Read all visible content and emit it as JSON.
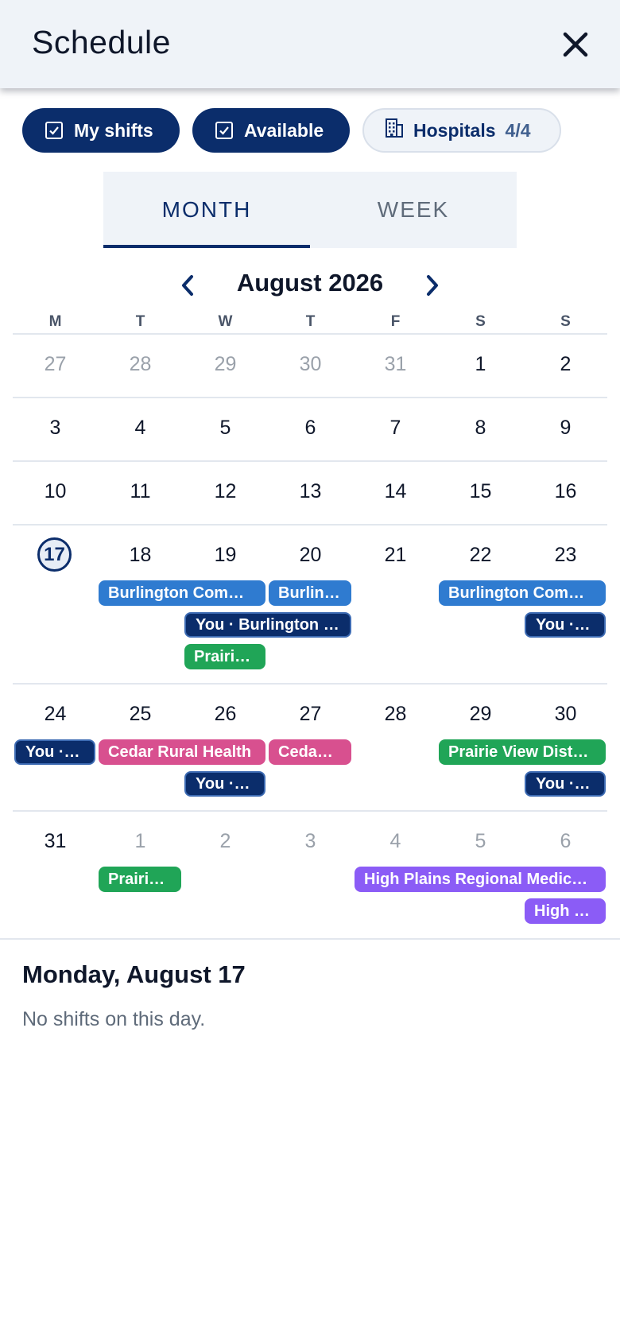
{
  "header": {
    "title": "Schedule"
  },
  "filters": {
    "my_shifts": "My shifts",
    "available": "Available",
    "hospitals_label": "Hospitals",
    "hospitals_count": "4/4"
  },
  "tabs": {
    "month": "MONTH",
    "week": "WEEK",
    "selected": "MONTH"
  },
  "calendar": {
    "month_title": "August 2026",
    "weekdays": [
      "M",
      "T",
      "W",
      "T",
      "F",
      "S",
      "S"
    ],
    "weeks": [
      [
        "27",
        "28",
        "29",
        "30",
        "31",
        "1",
        "2"
      ],
      [
        "3",
        "4",
        "5",
        "6",
        "7",
        "8",
        "9"
      ],
      [
        "10",
        "11",
        "12",
        "13",
        "14",
        "15",
        "16"
      ],
      [
        "17",
        "18",
        "19",
        "20",
        "21",
        "22",
        "23"
      ],
      [
        "24",
        "25",
        "26",
        "27",
        "28",
        "29",
        "30"
      ],
      [
        "31",
        "1",
        "2",
        "3",
        "4",
        "5",
        "6"
      ]
    ],
    "today": "17",
    "events": {
      "w4_burl_a": "Burlington Com…",
      "w4_burl_b": "Burlin…",
      "w4_burl_c": "Burlington Com…",
      "w4_you_a": "You · Burlington …",
      "w4_you_b": "You · …",
      "w4_prair": "Prairi…",
      "w5_you_a": "You · …",
      "w5_cedar_a": "Cedar Rural Health",
      "w5_cedar_b": "Ceda…",
      "w5_prair": "Prairie View Dist…",
      "w5_you_b": "You · …",
      "w5_you_c": "You · …",
      "w6_prair": "Prairi…",
      "w6_high_a": "High Plains Regional Medic…",
      "w6_high_b": "High …"
    },
    "colors": {
      "you": "#0b2d6b",
      "burlington": "#2f7bd0",
      "prairie": "#20a557",
      "cedar": "#d8508f",
      "high_plains": "#8b5cf6"
    }
  },
  "detail": {
    "date_title": "Monday, August 17",
    "empty_text": "No shifts on this day."
  },
  "icons": {
    "close": "close-icon",
    "checkbox": "checkbox-checked-icon",
    "hospital": "building-icon",
    "prev": "chevron-left-icon",
    "next": "chevron-right-icon"
  }
}
